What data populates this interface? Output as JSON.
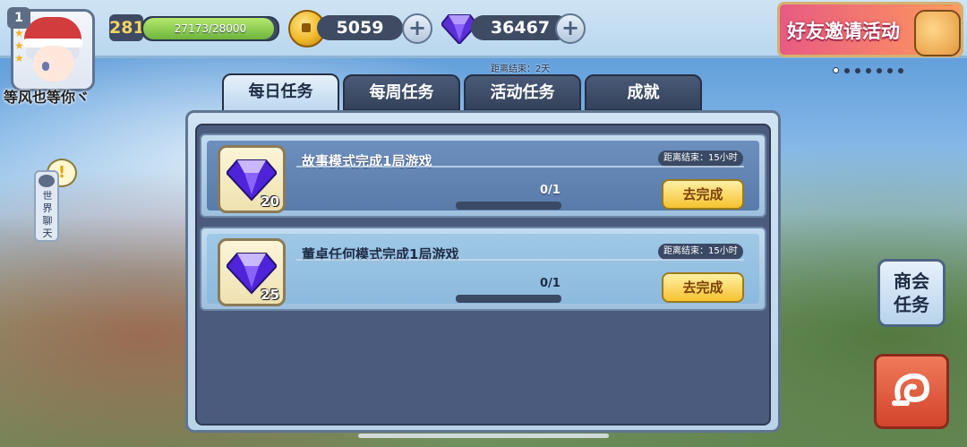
{
  "player": {
    "level_badge": "1",
    "name": "等风也等你ヾ",
    "level": "281",
    "exp_text": "27173/28000",
    "exp_progress": 0.97
  },
  "currency": {
    "coins": "5059",
    "gems": "36467"
  },
  "invite": {
    "label": "好友邀请活动"
  },
  "timer_top": "距离结束：2天",
  "tabs": [
    {
      "label": "每日任务",
      "active": true
    },
    {
      "label": "每周任务",
      "active": false
    },
    {
      "label": "活动任务",
      "active": false
    },
    {
      "label": "成就",
      "active": false
    }
  ],
  "tasks": [
    {
      "title": "故事模式完成1局游戏",
      "timer": "距离结束：15小时",
      "reward_count": "20",
      "progress": "0/1",
      "button": "去完成"
    },
    {
      "title": "董卓任何模式完成1局游戏",
      "timer": "距离结束：15小时",
      "reward_count": "25",
      "progress": "0/1",
      "button": "去完成"
    }
  ],
  "world_chat": {
    "label": "世界聊天",
    "alert": "!"
  },
  "guild_button": "商会任务",
  "colors": {
    "accent_gold": "#f5c230",
    "panel_dark": "#4a5b7e",
    "tab_active": "#e6f1fb",
    "return_red": "#d2442c"
  }
}
